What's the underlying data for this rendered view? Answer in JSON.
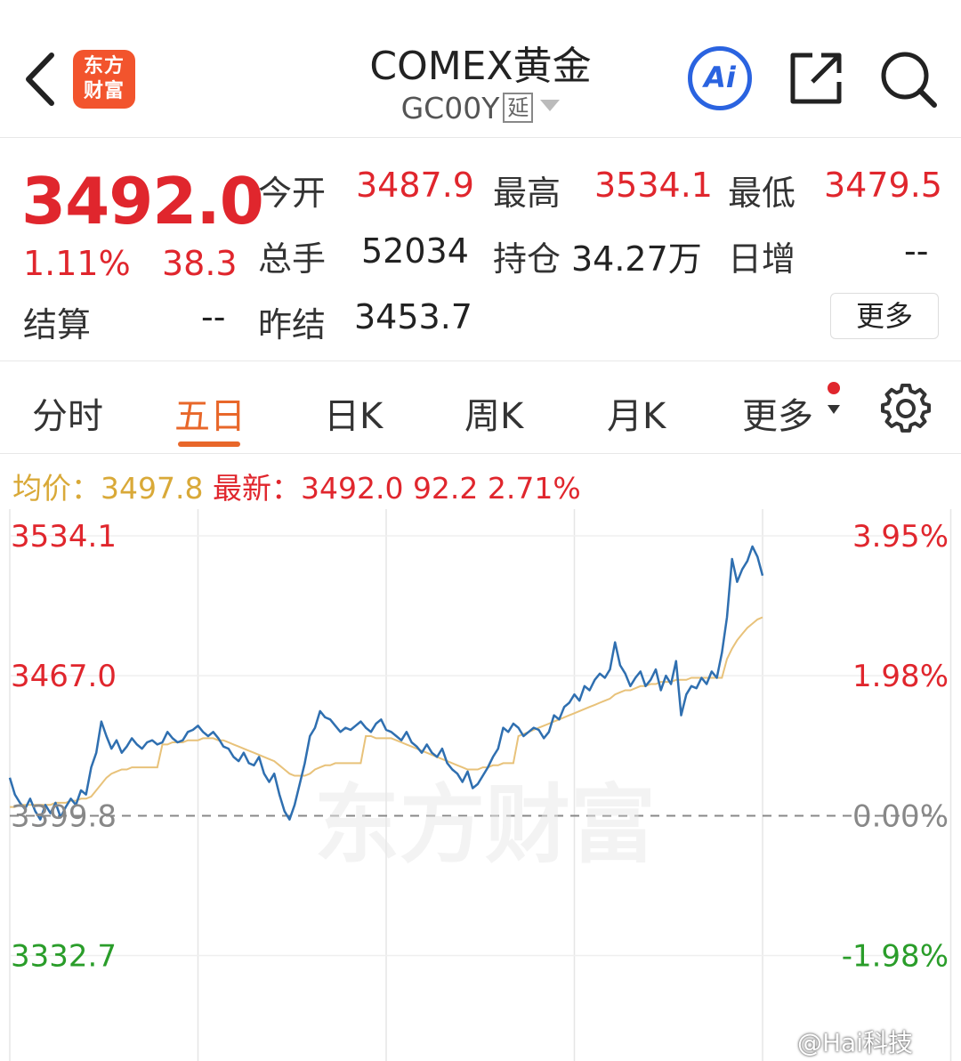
{
  "header": {
    "logo_line1": "东方",
    "logo_line2": "财富",
    "title": "COMEX黄金",
    "code": "GC00Y",
    "delay_tag": "延",
    "ai_label": "Ai"
  },
  "quote": {
    "price": "3492.0",
    "change_pct": "1.11%",
    "change_val": "38.3",
    "open_label": "今开",
    "open": "3487.9",
    "high_label": "最高",
    "high": "3534.1",
    "low_label": "最低",
    "low": "3479.5",
    "volume_label": "总手",
    "volume": "52034",
    "oi_label": "持仓",
    "oi": "34.27万",
    "daily_inc_label": "日增",
    "daily_inc": "--",
    "settle_label": "结算",
    "settle": "--",
    "prev_settle_label": "昨结",
    "prev_settle": "3453.7",
    "more_label": "更多"
  },
  "tabs": {
    "items": [
      "分时",
      "五日",
      "日K",
      "周K",
      "月K",
      "更多"
    ],
    "active": "五日"
  },
  "info": {
    "avg_label": "均价：",
    "avg": "3497.8",
    "latest_label": "最新：",
    "latest": "3492.0",
    "change": "92.2",
    "pct": "2.71%"
  },
  "chart_data": {
    "type": "line",
    "y_labels_left": [
      "3534.1",
      "3467.0",
      "3399.8",
      "3332.7"
    ],
    "y_labels_right": [
      "3.95%",
      "1.98%",
      "0.00%",
      "-1.98%"
    ],
    "ylim": [
      3299.2,
      3534.1
    ],
    "baseline": 3399.8,
    "days": 5,
    "series": [
      {
        "role": "price",
        "color": "#2f6fb0",
        "values": [
          3418,
          3410,
          3406,
          3403,
          3408,
          3402,
          3398,
          3405,
          3401,
          3406,
          3399,
          3404,
          3408,
          3405,
          3412,
          3410,
          3423,
          3430,
          3445,
          3438,
          3432,
          3436,
          3430,
          3433,
          3437,
          3434,
          3432,
          3435,
          3436,
          3434,
          3435,
          3440,
          3437,
          3435,
          3436,
          3440,
          3441,
          3443,
          3440,
          3438,
          3440,
          3437,
          3433,
          3432,
          3428,
          3426,
          3430,
          3425,
          3424,
          3428,
          3420,
          3416,
          3420,
          3410,
          3402,
          3398,
          3405,
          3415,
          3425,
          3438,
          3442,
          3450,
          3447,
          3446,
          3443,
          3440,
          3442,
          3441,
          3443,
          3445,
          3442,
          3440,
          3444,
          3446,
          3441,
          3440,
          3438,
          3436,
          3440,
          3435,
          3433,
          3430,
          3434,
          3430,
          3428,
          3432,
          3425,
          3422,
          3420,
          3416,
          3421,
          3413,
          3415,
          3419,
          3423,
          3428,
          3432,
          3442,
          3440,
          3444,
          3442,
          3438,
          3440,
          3442,
          3441,
          3437,
          3440,
          3448,
          3446,
          3452,
          3454,
          3458,
          3455,
          3462,
          3460,
          3465,
          3468,
          3466,
          3470,
          3483,
          3472,
          3468,
          3462,
          3466,
          3469,
          3462,
          3465,
          3470,
          3460,
          3467,
          3463,
          3474,
          3448,
          3458,
          3462,
          3461,
          3466,
          3463,
          3469,
          3466,
          3478,
          3495,
          3523,
          3512,
          3518,
          3522,
          3529,
          3524,
          3515
        ]
      },
      {
        "role": "average",
        "color": "#e8c27a",
        "values": [
          3404,
          3404,
          3405,
          3405,
          3405,
          3405,
          3405,
          3405,
          3405,
          3406,
          3406,
          3406,
          3407,
          3407,
          3408,
          3408,
          3409,
          3412,
          3415,
          3418,
          3420,
          3421,
          3422,
          3422,
          3423,
          3423,
          3423,
          3423,
          3423,
          3423,
          3434,
          3434,
          3435,
          3435,
          3435,
          3436,
          3436,
          3436,
          3437,
          3437,
          3437,
          3436,
          3436,
          3435,
          3434,
          3433,
          3432,
          3431,
          3430,
          3429,
          3428,
          3427,
          3426,
          3424,
          3422,
          3420,
          3419,
          3419,
          3419,
          3420,
          3422,
          3423,
          3424,
          3424,
          3425,
          3425,
          3425,
          3425,
          3425,
          3425,
          3438,
          3438,
          3437,
          3437,
          3437,
          3437,
          3436,
          3435,
          3434,
          3433,
          3432,
          3431,
          3430,
          3429,
          3428,
          3427,
          3426,
          3425,
          3424,
          3423,
          3422,
          3422,
          3422,
          3423,
          3423,
          3424,
          3424,
          3425,
          3425,
          3425,
          3438,
          3439,
          3440,
          3441,
          3442,
          3443,
          3444,
          3445,
          3446,
          3447,
          3448,
          3449,
          3450,
          3451,
          3452,
          3453,
          3454,
          3455,
          3456,
          3458,
          3459,
          3460,
          3460,
          3461,
          3462,
          3462,
          3463,
          3463,
          3464,
          3464,
          3464,
          3465,
          3465,
          3465,
          3466,
          3466,
          3466,
          3466,
          3466,
          3466,
          3466,
          3475,
          3480,
          3484,
          3487,
          3490,
          3492,
          3494,
          3495
        ]
      }
    ]
  }
}
